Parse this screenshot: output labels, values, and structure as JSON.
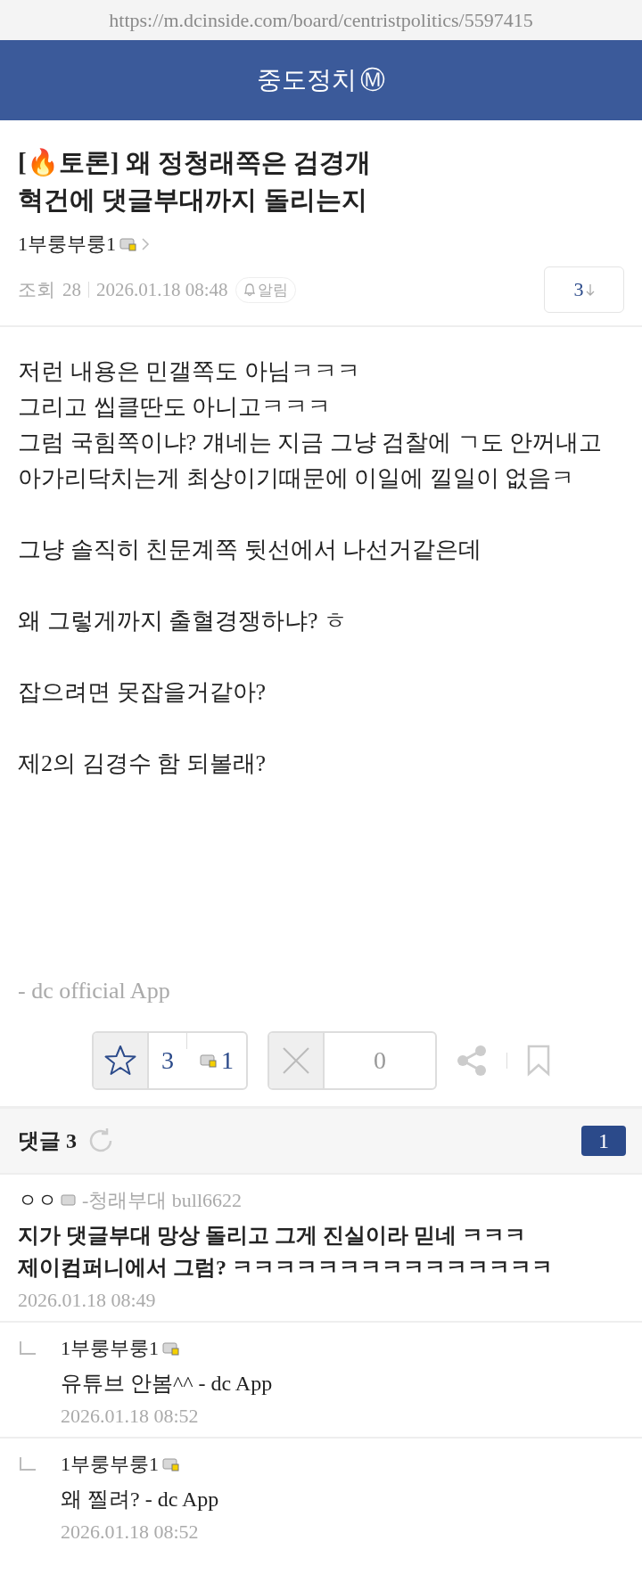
{
  "url": "https://m.dcinside.com/board/centristpolitics/5597415",
  "header": {
    "title": "중도정치",
    "badge": "Ⓜ"
  },
  "post": {
    "title": "[🔥토론] 왜 정청래쪽은 검경개 혁건에 댓글부대까지 돌리는지",
    "author": {
      "name": "1부룽부룽1",
      "fixed_member": true
    },
    "views_label": "조회",
    "views": "28",
    "date": "2026.01.18 08:48",
    "alarm": "알림",
    "comment_jump": "3",
    "paragraphs": [
      [
        "저런 내용은 민갤쪽도 아님ㅋㅋㅋ",
        "그리고 씹클딴도 아니고ㅋㅋㅋ",
        "그럼 국힘쪽이냐? 걔네는 지금 그냥 검찰에 ㄱ도 안꺼내고",
        "아가리닥치는게 최상이기때문에 이일에 낄일이 없음ㅋ"
      ],
      [
        "그냥 솔직히 친문계쪽 뒷선에서 나선거같은데"
      ],
      [
        "왜 그렇게까지 출혈경쟁하냐? ㅎ"
      ],
      [
        "잡으려면 못잡을거같아?"
      ],
      [
        "제2의 김경수 함 되볼래?"
      ]
    ],
    "signature": "- dc official App",
    "upvotes": "3",
    "fixed_upvotes": "1",
    "downvotes": "0"
  },
  "comments_header": {
    "label": "댓글 3",
    "page": "1"
  },
  "comments": [
    {
      "kind": "comment",
      "author": "ㅇㅇ",
      "fixed_member": false,
      "author_id": "-청래부대 bull6622",
      "text": "지가 댓글부대 망상 돌리고 그게 진실이라 믿네 ㅋㅋㅋ\n제이컴퍼니에서 그럼? ㅋㅋㅋㅋㅋㅋㅋㅋㅋㅋㅋㅋㅋㅋㅋ",
      "date": "2026.01.18 08:49"
    },
    {
      "kind": "reply",
      "author": "1부룽부룽1",
      "fixed_member": true,
      "text": "유튜브 안봄^^ - dc App",
      "date": "2026.01.18 08:52"
    },
    {
      "kind": "reply",
      "author": "1부룽부룽1",
      "fixed_member": true,
      "text": "왜 찔려? - dc App",
      "date": "2026.01.18 08:52"
    }
  ]
}
